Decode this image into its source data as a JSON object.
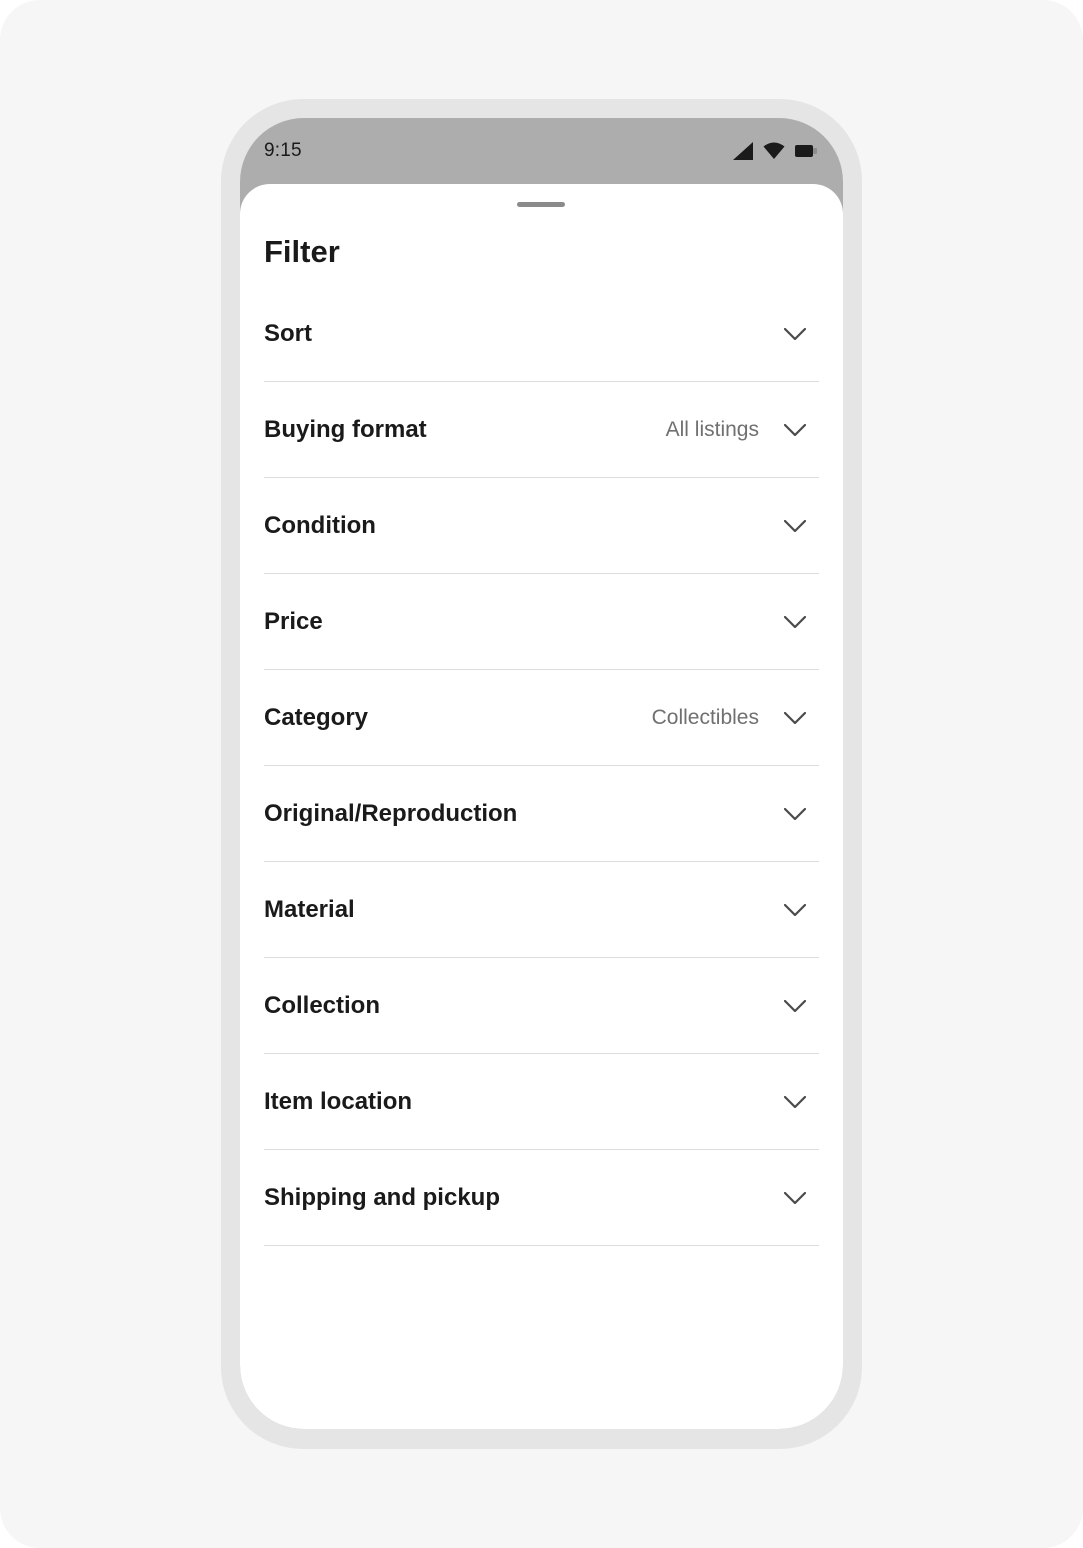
{
  "status_bar": {
    "time": "9:15",
    "icons": [
      "cellular-signal-icon",
      "wifi-icon",
      "battery-icon"
    ]
  },
  "sheet": {
    "title": "Filter",
    "filters": [
      {
        "label": "Sort",
        "value": ""
      },
      {
        "label": "Buying format",
        "value": "All listings"
      },
      {
        "label": "Condition",
        "value": ""
      },
      {
        "label": "Price",
        "value": ""
      },
      {
        "label": "Category",
        "value": "Collectibles"
      },
      {
        "label": "Original/Reproduction",
        "value": ""
      },
      {
        "label": "Material",
        "value": ""
      },
      {
        "label": "Collection",
        "value": ""
      },
      {
        "label": "Item location",
        "value": ""
      },
      {
        "label": "Shipping and pickup",
        "value": ""
      }
    ]
  },
  "colors": {
    "background": "#f6f6f6",
    "phone_frame": "#e5e5e5",
    "status_bar": "#adadad",
    "text_primary": "#1a1a1a",
    "text_secondary": "#707070",
    "divider": "#dcdcdc"
  }
}
